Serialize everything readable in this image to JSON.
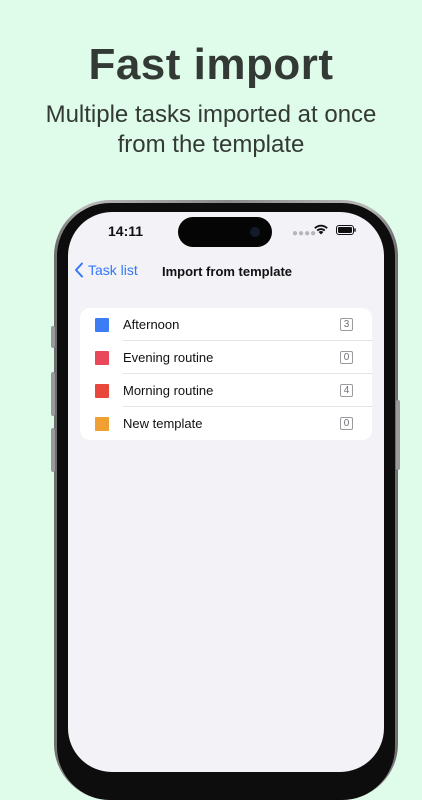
{
  "promo": {
    "headline": "Fast import",
    "subheadline_line1": "Multiple tasks imported at once",
    "subheadline_line2": "from the template"
  },
  "status_bar": {
    "time": "14:11",
    "signal_icon": "cellular-signal-icon",
    "wifi_icon": "wifi-icon",
    "battery_icon": "battery-icon"
  },
  "navbar": {
    "back_label": "Task list",
    "back_icon": "chevron-left-icon",
    "title": "Import from template"
  },
  "templates": [
    {
      "name": "Afternoon",
      "count": "3",
      "color": "#3c7cf4"
    },
    {
      "name": "Evening routine",
      "count": "0",
      "color": "#e9475a"
    },
    {
      "name": "Morning routine",
      "count": "4",
      "color": "#e8483c"
    },
    {
      "name": "New template",
      "count": "0",
      "color": "#f0a032"
    }
  ],
  "colors": {
    "background": "#dffbe9",
    "accent": "#3478f6",
    "screen_bg": "#f2f2f7"
  }
}
